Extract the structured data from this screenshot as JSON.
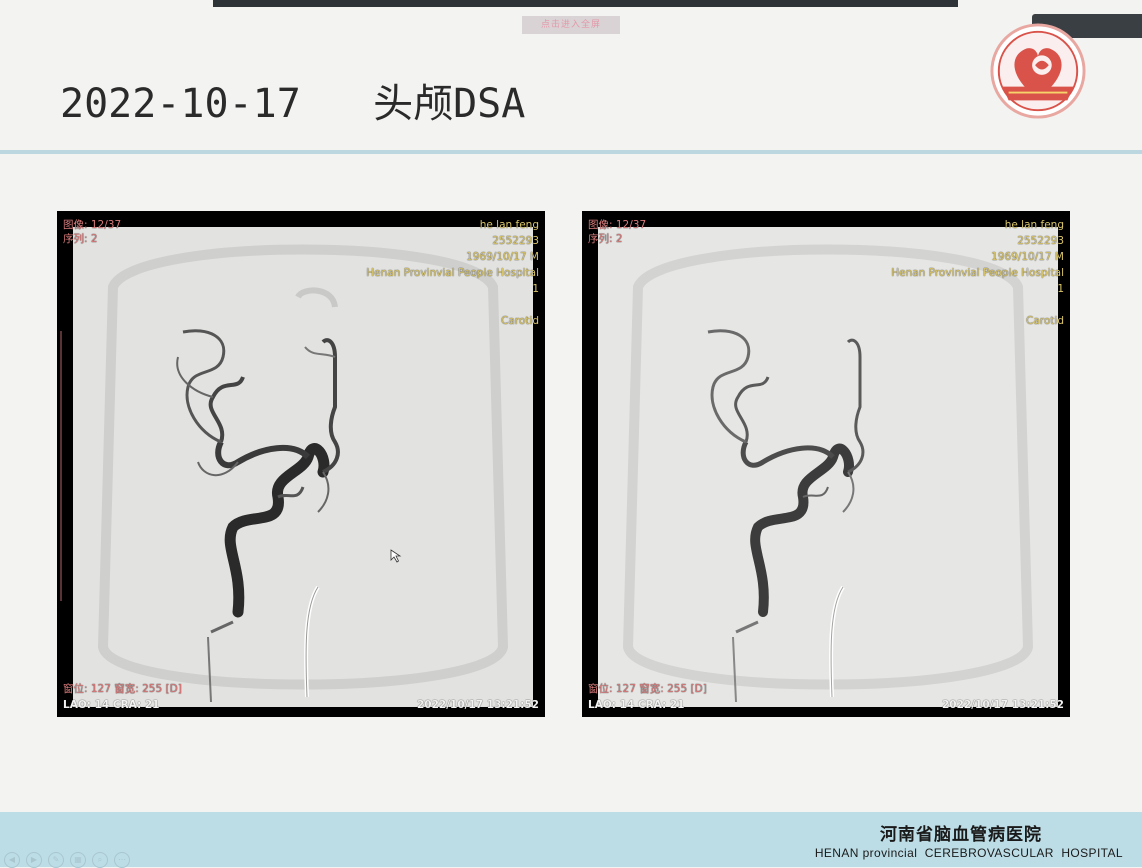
{
  "slide": {
    "title": "2022-10-17   头颅DSA",
    "top_label": "点击进入全屏",
    "hospital_cn": "河南省脑血管病医院",
    "hospital_en": "HENAN provincial  CEREBROVASCULAR  HOSPITAL"
  },
  "viewers": [
    {
      "image_count": "图像: 12/37",
      "series": "序列: 2",
      "patient_name": "he lan feng",
      "patient_id": "2552293",
      "dob_sex": "1969/10/17 M",
      "institution": "Henan Provinvial People Hospital",
      "number": "1",
      "region": "Carotid",
      "window": "窗位: 127 窗宽: 255 [D]",
      "angles": "LAO: 14 CRA: 21",
      "datetime": "2022/10/17 13:21:52"
    },
    {
      "image_count": "图像: 12/37",
      "series": "序列: 2",
      "patient_name": "he lan feng",
      "patient_id": "2552293",
      "dob_sex": "1969/10/17 M",
      "institution": "Henan Provinvial People Hospital",
      "number": "1",
      "region": "Carotid",
      "window": "窗位: 127 窗宽: 255 [D]",
      "angles": "LAO: 14 CRA: 21",
      "datetime": "2022/10/17 13:21:52"
    }
  ],
  "colors": {
    "accent_band": "#bcdde6",
    "title_rule": "#bcd7df",
    "logo_red": "#d9534a",
    "overlay_text": "#d8c56a"
  },
  "icons": [
    "hospital-logo-icon",
    "mouse-cursor-icon",
    "presentation-control-icon"
  ]
}
